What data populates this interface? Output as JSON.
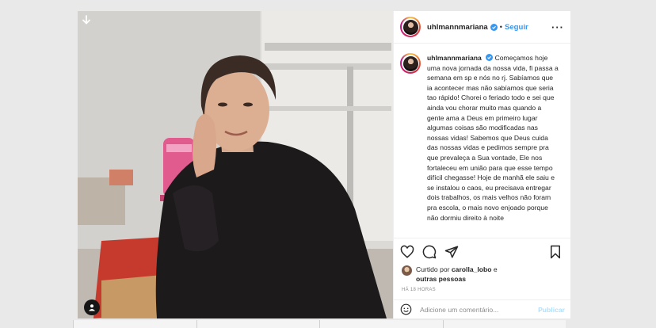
{
  "post": {
    "username": "uhlmannmariana",
    "follow_label": "Seguir",
    "separator": "•",
    "more_label": "···",
    "caption": "Começamos hoje uma nova jornada da nossa vida, fi passa a semana em sp e nós no rj. Sabíamos que ia acontecer mas não sabíamos que seria tao rápido! Chorei o feriado todo e sei que ainda vou chorar muito mas quando a gente ama a Deus em primeiro lugar algumas coisas são modificadas nas nossas vidas! Sabemos que Deus cuida das nossas vidas e pedimos sempre pra que prevaleça a Sua vontade, Ele nos fortaleceu em união para que esse tempo difícil chegasse! Hoje de manhã ele saiu e se instalou o caos, eu precisava entregar dois trabalhos, os mais velhos não foram pra escola, o mais novo enjoado porque não dormiu direito à noite",
    "liked_prefix": "Curtido por",
    "liked_user": "carolla_lobo",
    "liked_suffix": "e",
    "liked_others": "outras pessoas",
    "time": "HÁ 18 HORAS",
    "comment_placeholder": "Adicione um comentário...",
    "publish_label": "Publicar"
  },
  "icons": {
    "verified": "verified-badge-icon",
    "like": "heart-icon",
    "comment": "comment-icon",
    "share": "paper-plane-icon",
    "save": "bookmark-icon",
    "emoji": "emoji-icon",
    "tag": "user-tag-icon",
    "download": "arrow-down-icon"
  },
  "colors": {
    "accent": "#3897f0",
    "text": "#262626",
    "muted": "#8e8e8e",
    "publish_disabled": "#b2dffc"
  }
}
